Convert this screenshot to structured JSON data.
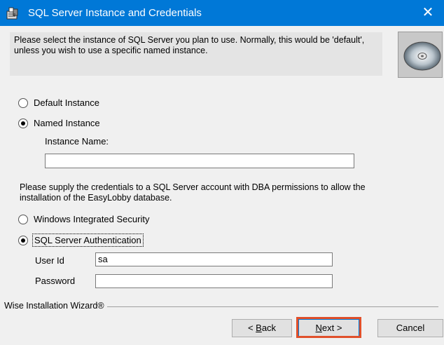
{
  "window": {
    "title": "SQL Server Instance and Credentials",
    "close_glyph": "✕"
  },
  "header": {
    "description": "Please select the instance of SQL Server you plan to use. Normally, this would be 'default', unless you wish to use a specific named instance.",
    "image_icon": "cd-disc-icon"
  },
  "instance": {
    "default_label": "Default Instance",
    "named_label": "Named Instance",
    "selected": "named",
    "instance_name_label": "Instance Name:",
    "instance_name_value": ""
  },
  "credentials": {
    "description": "Please supply the credentials to a SQL Server account with DBA permissions to allow the installation of the EasyLobby database.",
    "windows_label": "Windows Integrated Security",
    "sql_label": "SQL Server Authentication",
    "selected": "sql",
    "userid_label": "User Id",
    "userid_value": "sa",
    "password_label": "Password",
    "password_value": ""
  },
  "footer": {
    "brand": "Wise Installation Wizard®",
    "back_prefix": "< ",
    "back_key": "B",
    "back_rest": "ack",
    "next_key": "N",
    "next_rest": "ext >",
    "cancel_label": "Cancel"
  },
  "colors": {
    "titlebar": "#0078d7",
    "highlight": "#e0502b"
  }
}
